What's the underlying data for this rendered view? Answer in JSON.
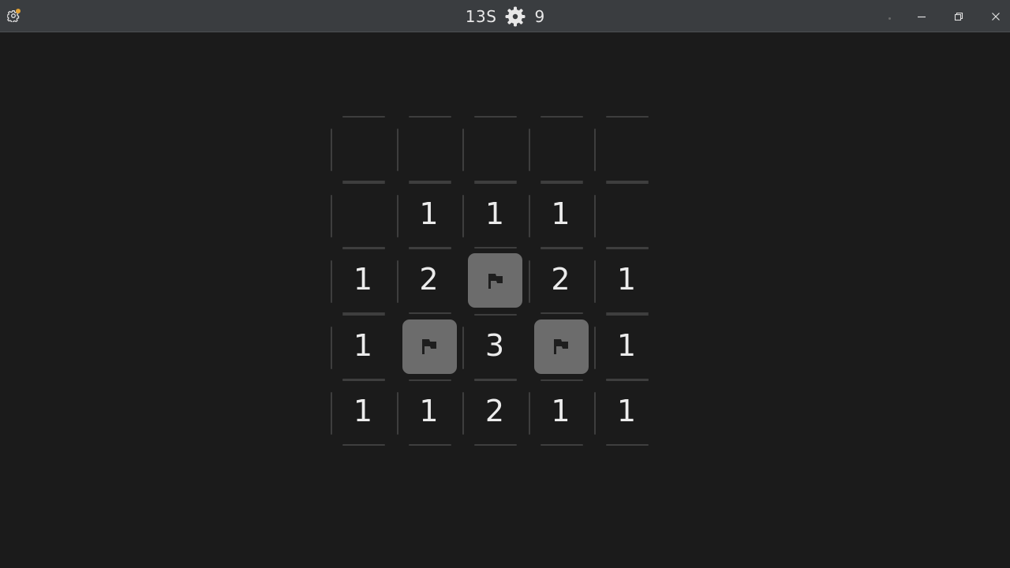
{
  "titlebar": {
    "timer": "13S",
    "mines_remaining": "9",
    "settings_icon": "gear-icon",
    "notification_color": "#e3a233",
    "mine_icon": "mine-icon",
    "controls": [
      "minimize-icon",
      "restore-icon",
      "close-icon"
    ]
  },
  "board": {
    "rows": 5,
    "cols": 5,
    "cells": [
      [
        "",
        "",
        "",
        "",
        ""
      ],
      [
        "",
        "1",
        "1",
        "1",
        ""
      ],
      [
        "1",
        "2",
        "F",
        "2",
        "1"
      ],
      [
        "1",
        "F",
        "3",
        "F",
        "1"
      ],
      [
        "1",
        "1",
        "2",
        "1",
        "1"
      ]
    ],
    "flag_icon": "flag-icon"
  },
  "colors": {
    "background": "#1b1b1b",
    "titlebar": "#3a3d40",
    "flag_tile": "#6c6c6c",
    "grid_line": "#3e3e3e"
  }
}
